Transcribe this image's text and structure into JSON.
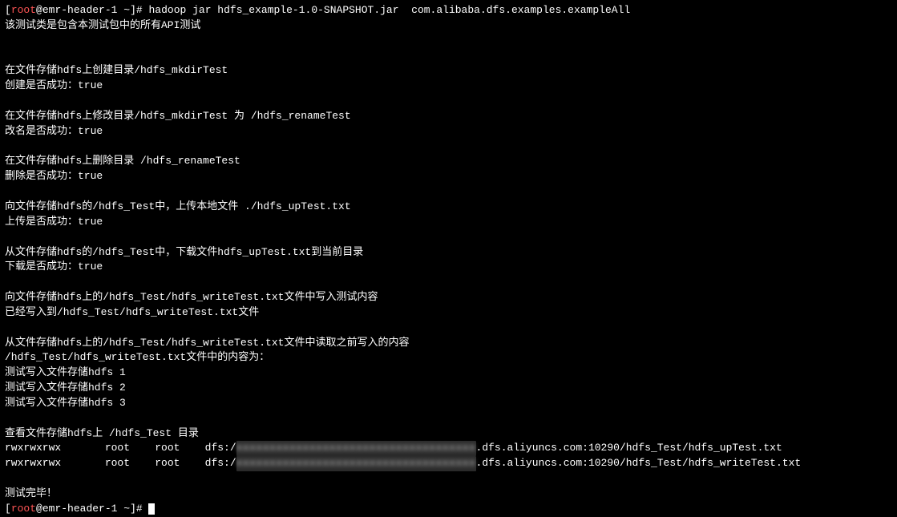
{
  "prompt": {
    "open_bracket": "[",
    "user": "root",
    "at": "@",
    "host": "emr-header-1 ",
    "path": "~",
    "close_bracket": "]# "
  },
  "command": "hadoop jar hdfs_example-1.0-SNAPSHOT.jar  com.alibaba.dfs.examples.exampleAll",
  "lines": {
    "l01": "该测试类是包含本测试包中的所有API测试",
    "l02": "在文件存储hdfs上创建目录/hdfs_mkdirTest",
    "l03": "创建是否成功：true",
    "l04": "在文件存储hdfs上修改目录/hdfs_mkdirTest 为 /hdfs_renameTest",
    "l05": "改名是否成功：true",
    "l06": "在文件存储hdfs上删除目录 /hdfs_renameTest",
    "l07": "删除是否成功：true",
    "l08": "向文件存储hdfs的/hdfs_Test中，上传本地文件 ./hdfs_upTest.txt",
    "l09": "上传是否成功：true",
    "l10": "从文件存储hdfs的/hdfs_Test中，下载文件hdfs_upTest.txt到当前目录",
    "l11": "下载是否成功：true",
    "l12": "向文件存储hdfs上的/hdfs_Test/hdfs_writeTest.txt文件中写入测试内容",
    "l13": "已经写入到/hdfs_Test/hdfs_writeTest.txt文件",
    "l14": "从文件存储hdfs上的/hdfs_Test/hdfs_writeTest.txt文件中读取之前写入的内容",
    "l15": "/hdfs_Test/hdfs_writeTest.txt文件中的内容为：",
    "l16": "测试写入文件存储hdfs 1",
    "l17": "测试写入文件存储hdfs 2",
    "l18": "测试写入文件存储hdfs 3",
    "l19": "查看文件存储hdfs上 /hdfs_Test 目录",
    "ls_row1_a": "rwxrwxrwx       root    root    dfs:/",
    "ls_row1_blur": "xxxxxxxxxxxxxxxxxxxxxxxxxxxxxxxxxxxx",
    "ls_row1_b": ".dfs.aliyuncs.com:10290/hdfs_Test/hdfs_upTest.txt",
    "ls_row2_a": "rwxrwxrwx       root    root    dfs:/",
    "ls_row2_blur": "xxxxxxxxxxxxxxxxxxxxxxxxxxxxxxxxxxxx",
    "ls_row2_b": ".dfs.aliyuncs.com:10290/hdfs_Test/hdfs_writeTest.txt",
    "l22": "测试完毕！"
  }
}
